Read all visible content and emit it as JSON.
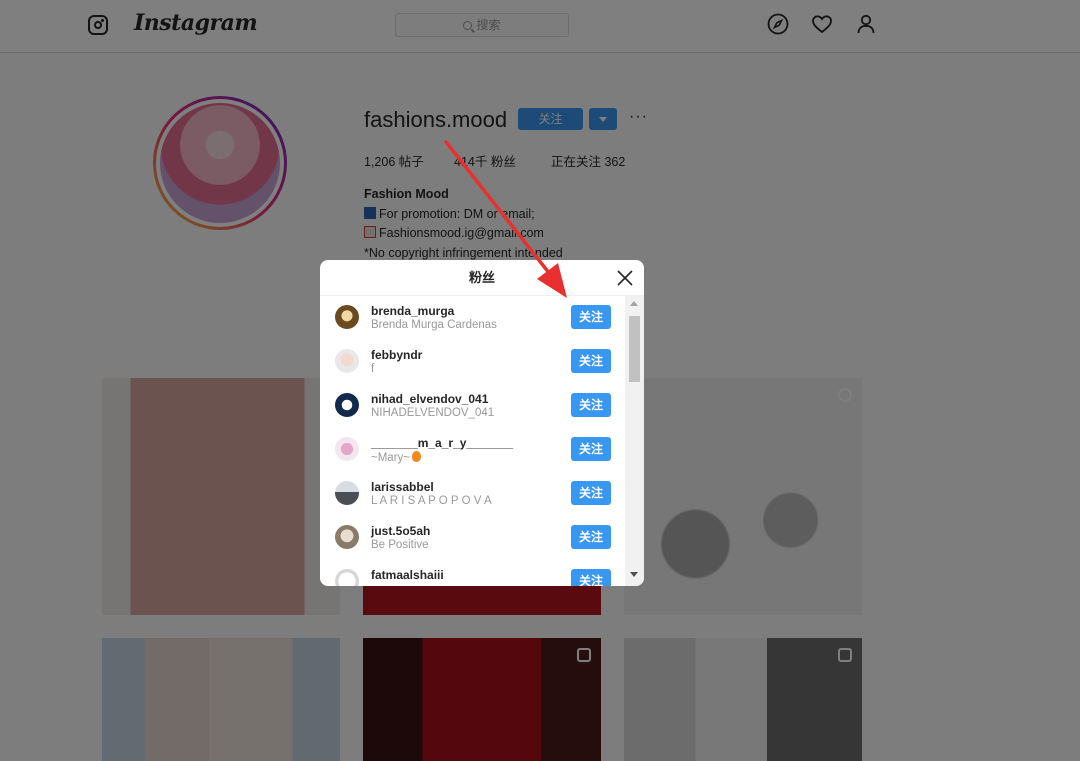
{
  "app": {
    "wordmark": "Instagram",
    "search_placeholder": "搜索",
    "nav_icons": [
      "compass-icon",
      "heart-icon",
      "person-icon"
    ]
  },
  "profile": {
    "username": "fashions.mood",
    "follow_label": "关注",
    "more_label": "···",
    "stats": {
      "posts": "1,206 帖子",
      "followers": "414千 粉丝",
      "following": "正在关注 362"
    },
    "bio": {
      "name": "Fashion Mood",
      "line1": "For promotion: DM or email;",
      "line2": "Fashionsmood.ig@gmail.com",
      "line3": "*No copyright infringement intended"
    }
  },
  "modal": {
    "title": "粉丝",
    "follow_label": "关注",
    "followers": [
      {
        "username": "brenda_murga",
        "fullname": "Brenda Murga Cardenas"
      },
      {
        "username": "febbyndr",
        "fullname": "f"
      },
      {
        "username": "nihad_elvendov_041",
        "fullname": "NIHADELVENDOV_041"
      },
      {
        "username": "_______m_a_r_y_______",
        "fullname": "~Mary~"
      },
      {
        "username": "larissabbel",
        "fullname": "L A R I S A P O P O V A"
      },
      {
        "username": "just.5o5ah",
        "fullname": "Be Positive"
      },
      {
        "username": "fatmaalshaiii",
        "fullname": ""
      }
    ]
  },
  "colors": {
    "accent": "#3897f0",
    "overlay": "rgba(0,0,0,0.5)",
    "annotation_arrow": "#e8312f"
  }
}
